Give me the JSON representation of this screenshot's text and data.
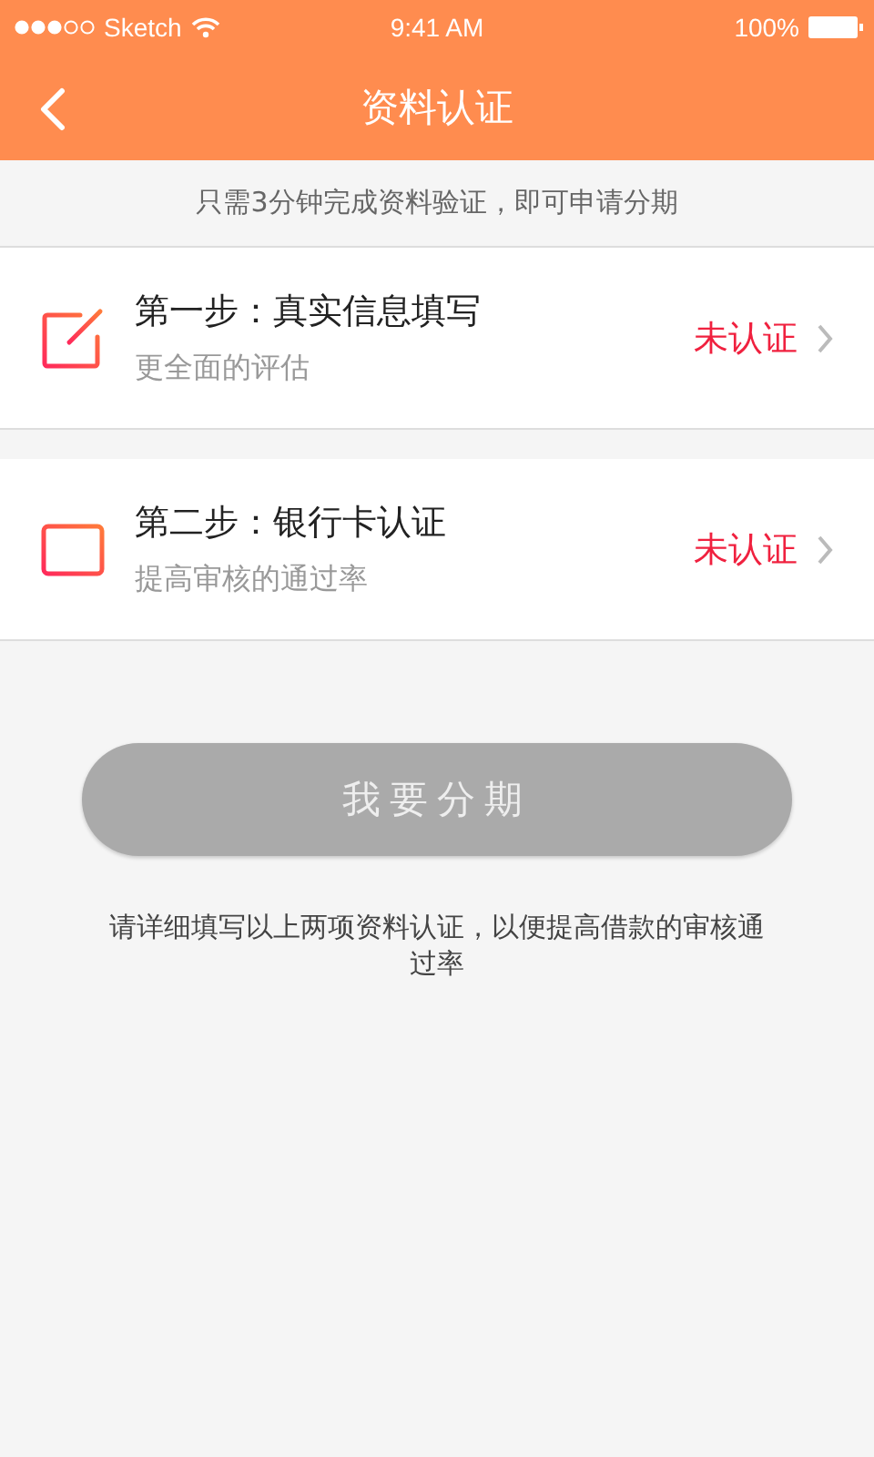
{
  "status_bar": {
    "carrier": "Sketch",
    "time": "9:41 AM",
    "battery": "100%"
  },
  "nav": {
    "title": "资料认证"
  },
  "notice": "只需3分钟完成资料验证，即可申请分期",
  "steps": [
    {
      "kind": "edit",
      "title": "第一步：真实信息填写",
      "subtitle": "更全面的评估",
      "status": "未认证",
      "verified": false
    },
    {
      "kind": "card",
      "title": "第二步：银行卡认证",
      "subtitle": "提高审核的通过率",
      "status": "未认证",
      "verified": false
    }
  ],
  "submit": {
    "label": "我要分期",
    "disabled": true
  },
  "footer": "请详细填写以上两项资料认证，以便提高借款的审核通过率"
}
